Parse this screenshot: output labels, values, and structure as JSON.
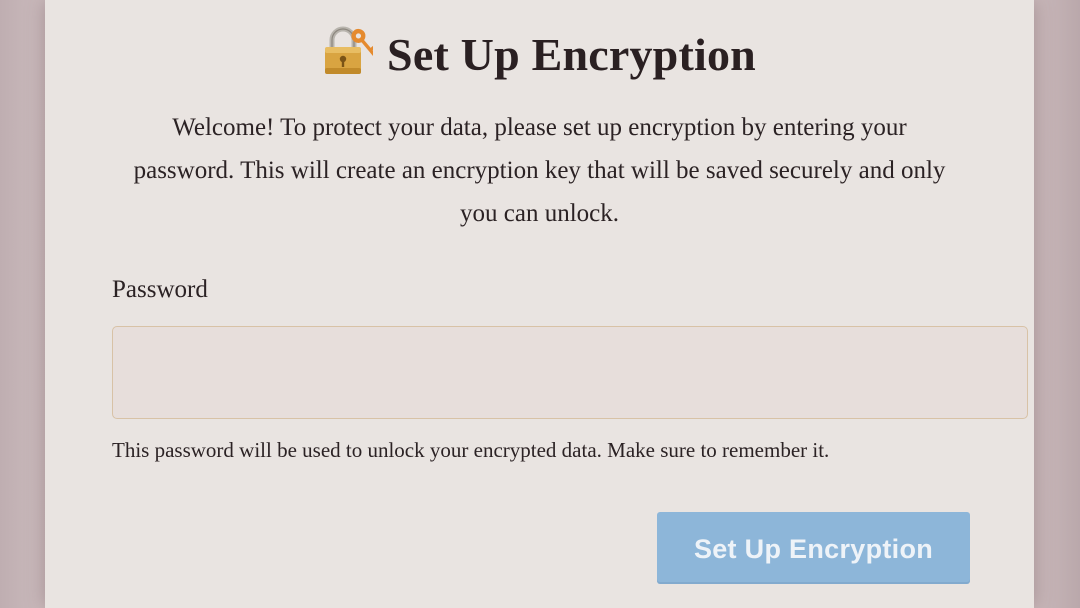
{
  "dialog": {
    "title_icon": "locked-with-key-icon",
    "title": "Set Up Encryption",
    "intro_lines": [
      "Welcome! To protect your data, please set up encryption by entering your",
      "password. This will create an encryption key that will be saved securely and only",
      "you can unlock."
    ],
    "password_label": "Password",
    "password_value": "",
    "password_placeholder": "",
    "help_text": "This password will be used to unlock your encrypted data. Make sure to remember it.",
    "submit_label": "Set Up Encryption"
  },
  "colors": {
    "modal_background": "#e9e4e1",
    "input_background": "#e7dedb",
    "input_border": "#d8c2a6",
    "button_background": "#8db6d9",
    "button_text": "#eef3f8",
    "text": "#2b2224"
  }
}
